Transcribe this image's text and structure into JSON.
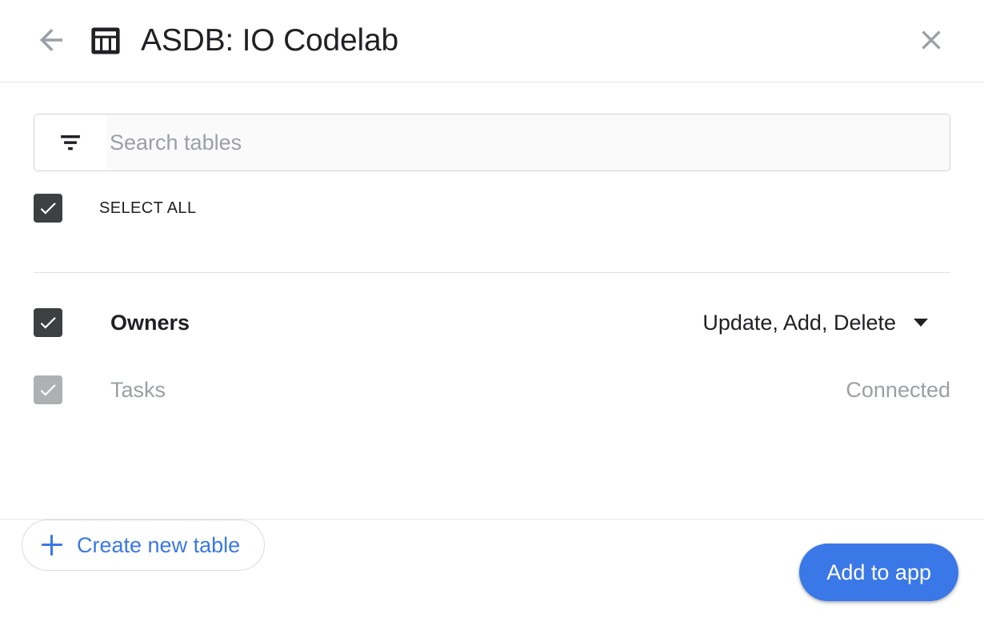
{
  "header": {
    "back_icon": "arrow-back-icon",
    "app_icon": "table-icon",
    "title": "ASDB: IO Codelab",
    "close_icon": "close-icon"
  },
  "search": {
    "filter_icon": "filter-list-icon",
    "placeholder": "Search tables",
    "value": ""
  },
  "select_all": {
    "label": "SELECT ALL",
    "checked": true
  },
  "tables": [
    {
      "name": "Owners",
      "checked": true,
      "disabled": false,
      "permission": "Update, Add, Delete",
      "has_dropdown": true
    },
    {
      "name": "Tasks",
      "checked": true,
      "disabled": true,
      "permission": "Connected",
      "has_dropdown": false
    }
  ],
  "create_table_button": {
    "label": "Create new table",
    "icon": "plus-icon"
  },
  "footer": {
    "primary_button": "Add to app"
  },
  "colors": {
    "accent_blue": "#3b78e7",
    "checkbox_dark": "#3c4043",
    "checkbox_disabled": "#aeb1b4",
    "muted_text": "#9aa0a6",
    "divider": "#e0e2e5"
  }
}
